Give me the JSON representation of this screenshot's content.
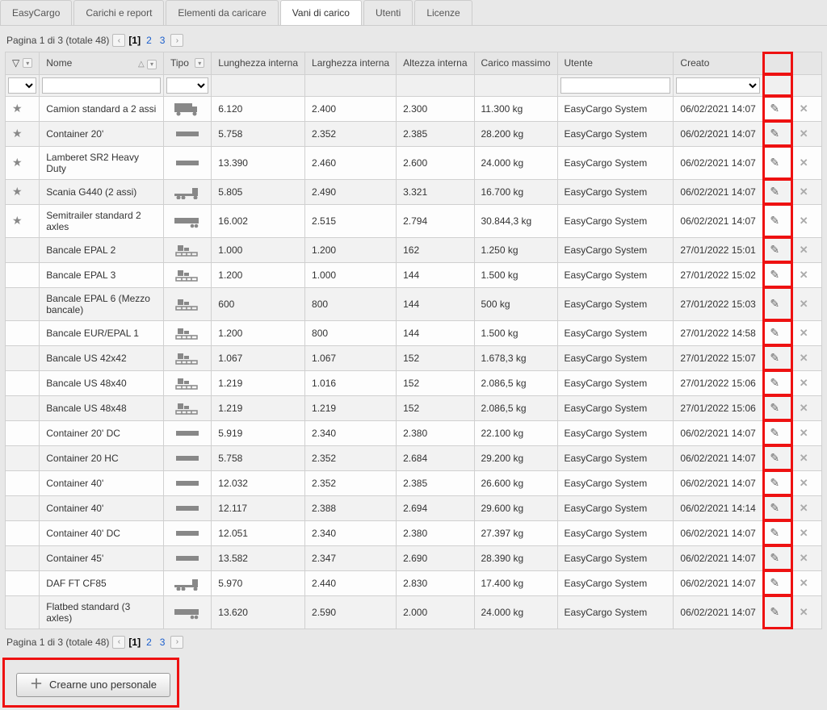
{
  "tabs": [
    {
      "label": "EasyCargo",
      "active": false
    },
    {
      "label": "Carichi e report",
      "active": false
    },
    {
      "label": "Elementi da caricare",
      "active": false
    },
    {
      "label": "Vani di carico",
      "active": true
    },
    {
      "label": "Utenti",
      "active": false
    },
    {
      "label": "Licenze",
      "active": false
    }
  ],
  "pager": {
    "summary_prefix": "Pagina 1 di 3 (totale 48)",
    "pages": [
      "1",
      "2",
      "3"
    ],
    "current": "1"
  },
  "columns": {
    "star": "",
    "name": "Nome",
    "type": "Tipo",
    "len": "Lunghezza interna",
    "wid": "Larghezza interna",
    "hei": "Altezza interna",
    "load": "Carico massimo",
    "user": "Utente",
    "created": "Creato"
  },
  "rows": [
    {
      "star": true,
      "name": "Camion standard a 2 assi",
      "type": "truck",
      "len": "6.120",
      "wid": "2.400",
      "hei": "2.300",
      "load": "11.300 kg",
      "user": "EasyCargo System",
      "created": "06/02/2021 14:07"
    },
    {
      "star": true,
      "name": "Container 20'",
      "type": "container",
      "len": "5.758",
      "wid": "2.352",
      "hei": "2.385",
      "load": "28.200 kg",
      "user": "EasyCargo System",
      "created": "06/02/2021 14:07"
    },
    {
      "star": true,
      "name": "Lamberet SR2 Heavy Duty",
      "type": "container",
      "len": "13.390",
      "wid": "2.460",
      "hei": "2.600",
      "load": "24.000 kg",
      "user": "EasyCargo System",
      "created": "06/02/2021 14:07"
    },
    {
      "star": true,
      "name": "Scania G440 (2 assi)",
      "type": "tractor",
      "len": "5.805",
      "wid": "2.490",
      "hei": "3.321",
      "load": "16.700 kg",
      "user": "EasyCargo System",
      "created": "06/02/2021 14:07"
    },
    {
      "star": true,
      "name": "Semitrailer standard 2 axles",
      "type": "trailer",
      "len": "16.002",
      "wid": "2.515",
      "hei": "2.794",
      "load": "30.844,3 kg",
      "user": "EasyCargo System",
      "created": "06/02/2021 14:07"
    },
    {
      "star": false,
      "name": "Bancale EPAL 2",
      "type": "pallet",
      "len": "1.000",
      "wid": "1.200",
      "hei": "162",
      "load": "1.250 kg",
      "user": "EasyCargo System",
      "created": "27/01/2022 15:01"
    },
    {
      "star": false,
      "name": "Bancale EPAL 3",
      "type": "pallet",
      "len": "1.200",
      "wid": "1.000",
      "hei": "144",
      "load": "1.500 kg",
      "user": "EasyCargo System",
      "created": "27/01/2022 15:02"
    },
    {
      "star": false,
      "name": "Bancale EPAL 6 (Mezzo bancale)",
      "type": "pallet",
      "len": "600",
      "wid": "800",
      "hei": "144",
      "load": "500 kg",
      "user": "EasyCargo System",
      "created": "27/01/2022 15:03"
    },
    {
      "star": false,
      "name": "Bancale EUR/EPAL 1",
      "type": "pallet",
      "len": "1.200",
      "wid": "800",
      "hei": "144",
      "load": "1.500 kg",
      "user": "EasyCargo System",
      "created": "27/01/2022 14:58"
    },
    {
      "star": false,
      "name": "Bancale US 42x42",
      "type": "pallet",
      "len": "1.067",
      "wid": "1.067",
      "hei": "152",
      "load": "1.678,3 kg",
      "user": "EasyCargo System",
      "created": "27/01/2022 15:07"
    },
    {
      "star": false,
      "name": "Bancale US 48x40",
      "type": "pallet",
      "len": "1.219",
      "wid": "1.016",
      "hei": "152",
      "load": "2.086,5 kg",
      "user": "EasyCargo System",
      "created": "27/01/2022 15:06"
    },
    {
      "star": false,
      "name": "Bancale US 48x48",
      "type": "pallet",
      "len": "1.219",
      "wid": "1.219",
      "hei": "152",
      "load": "2.086,5 kg",
      "user": "EasyCargo System",
      "created": "27/01/2022 15:06"
    },
    {
      "star": false,
      "name": "Container 20' DC",
      "type": "container",
      "len": "5.919",
      "wid": "2.340",
      "hei": "2.380",
      "load": "22.100 kg",
      "user": "EasyCargo System",
      "created": "06/02/2021 14:07"
    },
    {
      "star": false,
      "name": "Container 20 HC",
      "type": "container",
      "len": "5.758",
      "wid": "2.352",
      "hei": "2.684",
      "load": "29.200 kg",
      "user": "EasyCargo System",
      "created": "06/02/2021 14:07"
    },
    {
      "star": false,
      "name": "Container 40'",
      "type": "container",
      "len": "12.032",
      "wid": "2.352",
      "hei": "2.385",
      "load": "26.600 kg",
      "user": "EasyCargo System",
      "created": "06/02/2021 14:07"
    },
    {
      "star": false,
      "name": "Container 40'",
      "type": "container",
      "len": "12.117",
      "wid": "2.388",
      "hei": "2.694",
      "load": "29.600 kg",
      "user": "EasyCargo System",
      "created": "06/02/2021 14:14"
    },
    {
      "star": false,
      "name": "Container 40' DC",
      "type": "container",
      "len": "12.051",
      "wid": "2.340",
      "hei": "2.380",
      "load": "27.397 kg",
      "user": "EasyCargo System",
      "created": "06/02/2021 14:07"
    },
    {
      "star": false,
      "name": "Container 45'",
      "type": "container",
      "len": "13.582",
      "wid": "2.347",
      "hei": "2.690",
      "load": "28.390 kg",
      "user": "EasyCargo System",
      "created": "06/02/2021 14:07"
    },
    {
      "star": false,
      "name": "DAF FT CF85",
      "type": "tractor",
      "len": "5.970",
      "wid": "2.440",
      "hei": "2.830",
      "load": "17.400 kg",
      "user": "EasyCargo System",
      "created": "06/02/2021 14:07"
    },
    {
      "star": false,
      "name": "Flatbed standard (3 axles)",
      "type": "trailer",
      "len": "13.620",
      "wid": "2.590",
      "hei": "2.000",
      "load": "24.000 kg",
      "user": "EasyCargo System",
      "created": "06/02/2021 14:07"
    }
  ],
  "create_button": "Crearne uno personale"
}
